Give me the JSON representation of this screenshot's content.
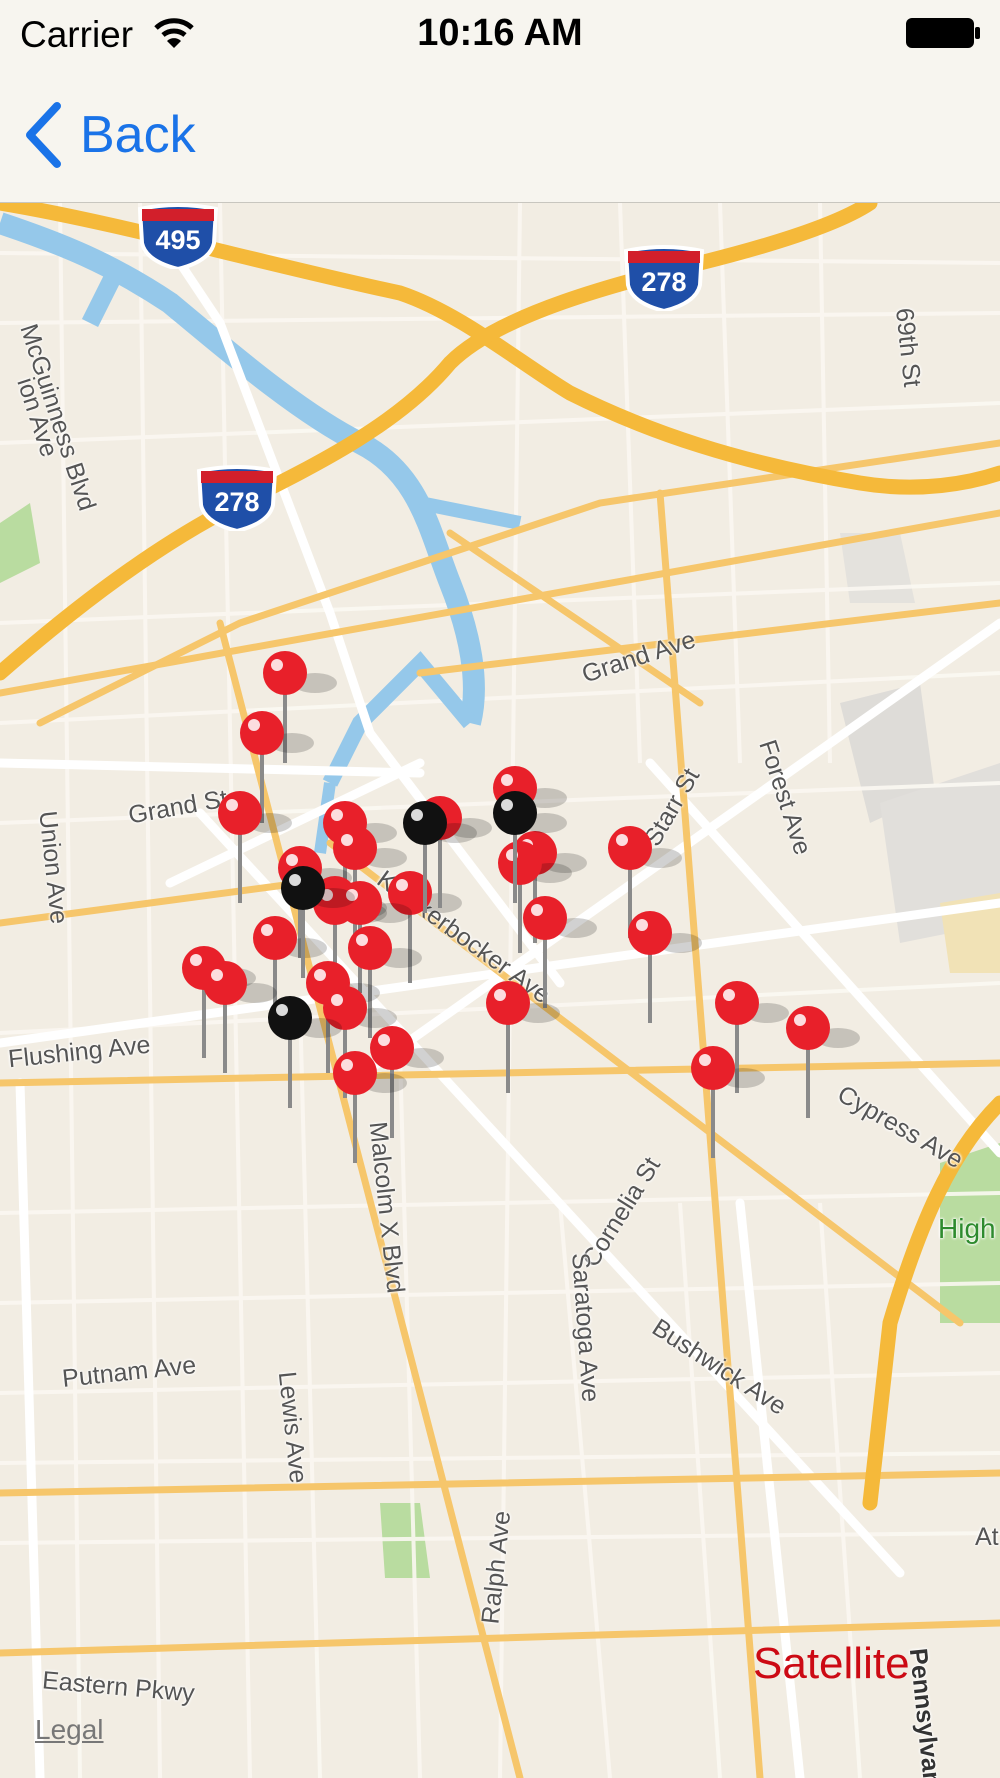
{
  "status_bar": {
    "carrier": "Carrier",
    "time": "10:16 AM"
  },
  "nav": {
    "back_label": "Back"
  },
  "map": {
    "highway_shields": [
      "495",
      "278",
      "278"
    ],
    "street_labels": [
      "McGuinness Blvd",
      "ion Ave",
      "69th St",
      "Grand Ave",
      "Grand St",
      "Union Ave",
      "Forest Ave",
      "Starr St",
      "Knickerbocker Ave",
      "Flushing Ave",
      "Cypress Ave",
      "Cornelia St",
      "Malcolm X Blvd",
      "Saratoga Ave",
      "Bushwick Ave",
      "Putnam Ave",
      "Lewis Ave",
      "Ralph Ave",
      "Eastern Pkwy",
      "Pennsylvan",
      "High",
      "At"
    ],
    "pin_count_red": 29,
    "pin_count_black": 4
  },
  "controls": {
    "satellite_label": "Satellite",
    "legal_label": "Legal"
  },
  "colors": {
    "accent_blue": "#1a73e8",
    "satellite_red": "#cc0a14",
    "pin_red": "#e8202a",
    "highway_orange": "#f5b93a",
    "water": "#95c8ea"
  }
}
